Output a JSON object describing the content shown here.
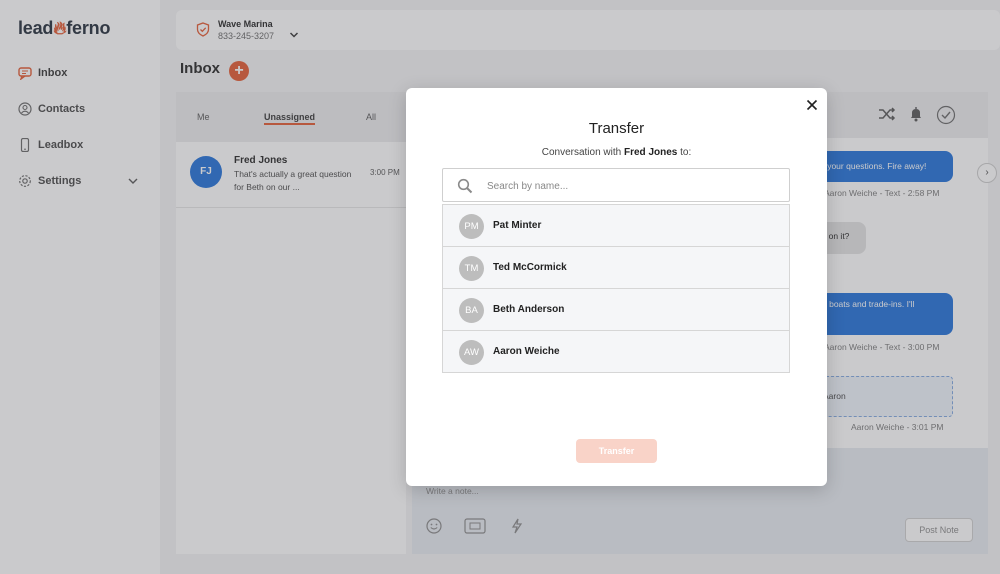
{
  "brand": {
    "logo_part1": "lead",
    "logo_part2": "ferno"
  },
  "sidebar": {
    "items": [
      {
        "label": "Inbox",
        "icon": "chat-icon"
      },
      {
        "label": "Contacts",
        "icon": "users-icon"
      },
      {
        "label": "Leadbox",
        "icon": "phone-icon"
      },
      {
        "label": "Settings",
        "icon": "gear-icon"
      }
    ]
  },
  "header": {
    "account_name": "Wave Marina",
    "account_phone": "833-245-3207"
  },
  "inbox": {
    "title": "Inbox",
    "add_label": "+",
    "tabs": [
      "Me",
      "Unassigned",
      "All"
    ],
    "active_tab": "Unassigned",
    "conversation": {
      "initials": "FJ",
      "name": "Fred Jones",
      "snippet": "That's actually a great question for Beth on our ...",
      "time": "3:00 PM"
    }
  },
  "chat": {
    "messages": [
      {
        "text": "r your questions. Fire away!",
        "meta": "Aaron Weiche - Text - 2:58 PM"
      },
      {
        "text": "s on it?"
      },
      {
        "text": "d boats and trade-ins. I'll",
        "meta": "Aaron Weiche - Text - 3:00 PM"
      },
      {
        "text": "Aaron",
        "meta": "Aaron Weiche - 3:01 PM"
      }
    ],
    "note_placeholder": "Write a note...",
    "post_note_label": "Post Note",
    "scroll_arrow": "›"
  },
  "modal": {
    "title": "Transfer",
    "subtitle_prefix": "Conversation with",
    "subtitle_name": "Fred Jones",
    "subtitle_suffix": "to:",
    "search_placeholder": "Search by name...",
    "agents": [
      {
        "initials": "PM",
        "name": "Pat Minter"
      },
      {
        "initials": "TM",
        "name": "Ted McCormick"
      },
      {
        "initials": "BA",
        "name": "Beth Anderson"
      },
      {
        "initials": "AW",
        "name": "Aaron Weiche"
      }
    ],
    "transfer_label": "Transfer"
  },
  "colors": {
    "accent": "#e4572e",
    "primary_blue": "#1e6fd9",
    "transfer_disabled": "#f9d3c8"
  }
}
